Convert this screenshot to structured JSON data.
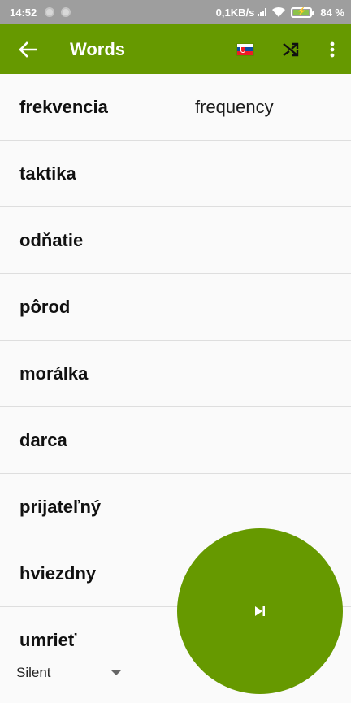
{
  "status_bar": {
    "time": "14:52",
    "network_speed": "0,1KB/s",
    "battery_percent": "84 %"
  },
  "app_bar": {
    "title": "Words",
    "color": "#669900",
    "icons": [
      "back-arrow-icon",
      "slovakia-flag-icon",
      "shuffle-icon",
      "more-vert-icon"
    ]
  },
  "words": [
    {
      "word": "frekvencia",
      "translation": "frequency"
    },
    {
      "word": "taktika",
      "translation": ""
    },
    {
      "word": "odňatie",
      "translation": ""
    },
    {
      "word": "pôrod",
      "translation": ""
    },
    {
      "word": "morálka",
      "translation": ""
    },
    {
      "word": "darca",
      "translation": ""
    },
    {
      "word": "prijateľný",
      "translation": ""
    },
    {
      "word": "hviezdny",
      "translation": ""
    },
    {
      "word": "umrieť",
      "translation": ""
    }
  ],
  "mode_select": {
    "value": "Silent"
  },
  "fab": {
    "icon": "skip-next-icon"
  }
}
